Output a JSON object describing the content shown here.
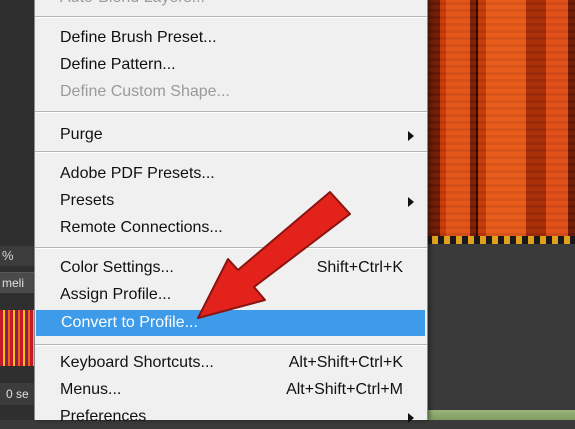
{
  "left_panel": {
    "zoom_text": "%",
    "tab_text": "meli",
    "time_text": "0 se"
  },
  "menu": {
    "items": [
      {
        "label": "Auto-Blend Layers...",
        "disabled": true
      },
      {
        "label": "Define Brush Preset..."
      },
      {
        "label": "Define Pattern..."
      },
      {
        "label": "Define Custom Shape...",
        "disabled": true
      },
      {
        "label": "Purge"
      },
      {
        "label": "Adobe PDF Presets..."
      },
      {
        "label": "Presets"
      },
      {
        "label": "Remote Connections..."
      },
      {
        "label": "Color Settings...",
        "shortcut": "Shift+Ctrl+K"
      },
      {
        "label": "Assign Profile..."
      },
      {
        "label": "Convert to Profile...",
        "selected": true
      },
      {
        "label": "Keyboard Shortcuts...",
        "shortcut": "Alt+Shift+Ctrl+K"
      },
      {
        "label": "Menus...",
        "shortcut": "Alt+Shift+Ctrl+M"
      },
      {
        "label": "Preferences"
      }
    ],
    "submenu_arrow_icon": "chevron-right-icon"
  },
  "annotation": {
    "arrow_color": "#e3221c",
    "arrow_icon": "red-arrow-pointer"
  },
  "colors": {
    "highlight": "#3d9be9",
    "menu_bg": "#f0f0f0"
  }
}
